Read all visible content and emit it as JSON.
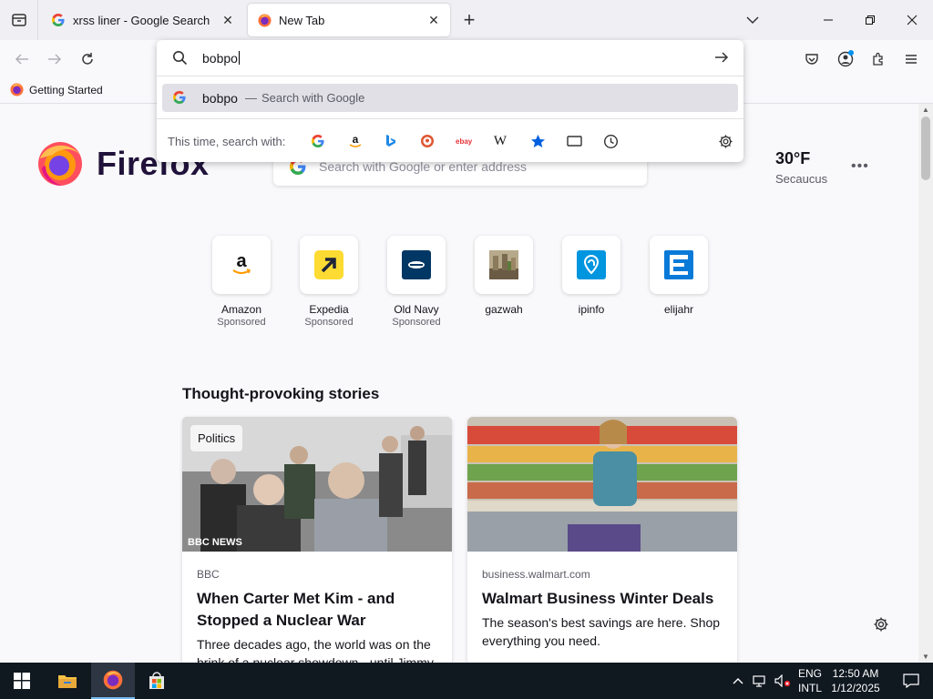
{
  "browser": {
    "tabs": [
      {
        "title": "xrss liner - Google Search",
        "favicon": "google-icon",
        "active": false
      },
      {
        "title": "New Tab",
        "favicon": "firefox-icon",
        "active": true
      }
    ],
    "bookmarks": [
      {
        "label": "Getting Started",
        "icon": "firefox-icon"
      }
    ]
  },
  "urlbar": {
    "typed": "bobpo",
    "suggestion": {
      "query": "bobpo",
      "separator": "—",
      "action": "Search with Google"
    },
    "oneoffs_label": "This time, search with:",
    "engines": [
      "google-icon",
      "amazon-icon",
      "bing-icon",
      "duckduckgo-icon",
      "ebay-icon",
      "wikipedia-icon",
      "bookmarks-star-icon",
      "tabs-icon",
      "history-icon"
    ],
    "wikipedia_glyph": "W",
    "ebay_glyph": "ebay"
  },
  "newtab": {
    "brand": "Firefox",
    "search_placeholder": "Search with Google or enter address",
    "weather": {
      "temp": "30°F",
      "city": "Secaucus"
    },
    "shortcuts": [
      {
        "name": "Amazon",
        "sponsored": "Sponsored",
        "icon": "amazon-icon"
      },
      {
        "name": "Expedia",
        "sponsored": "Sponsored",
        "icon": "expedia-icon"
      },
      {
        "name": "Old Navy",
        "sponsored": "Sponsored",
        "icon": "old-navy-icon"
      },
      {
        "name": "gazwah",
        "sponsored": "",
        "icon": "gazwah-icon"
      },
      {
        "name": "ipinfo",
        "sponsored": "",
        "icon": "ipinfo-icon"
      },
      {
        "name": "elijahr",
        "sponsored": "",
        "icon": "elijahr-icon"
      }
    ],
    "stories_title": "Thought-provoking stories",
    "stories": [
      {
        "tag": "Politics",
        "source": "BBC",
        "image_caption": "BBC NEWS",
        "headline": "When Carter Met Kim - and Stopped a Nuclear War",
        "excerpt": "Three decades ago, the world was on the brink of a nuclear showdown - until Jimmy"
      },
      {
        "tag": "",
        "source": "business.walmart.com",
        "headline": "Walmart Business Winter Deals",
        "excerpt": "The season's best savings are here. Shop everything you need."
      }
    ]
  },
  "taskbar": {
    "lang_line1": "ENG",
    "lang_line2": "INTL",
    "time": "12:50 AM",
    "date": "1/12/2025"
  },
  "colors": {
    "accent": "#0060df",
    "taskbar": "#101820",
    "suggestion_bg": "#e0e0e6"
  }
}
